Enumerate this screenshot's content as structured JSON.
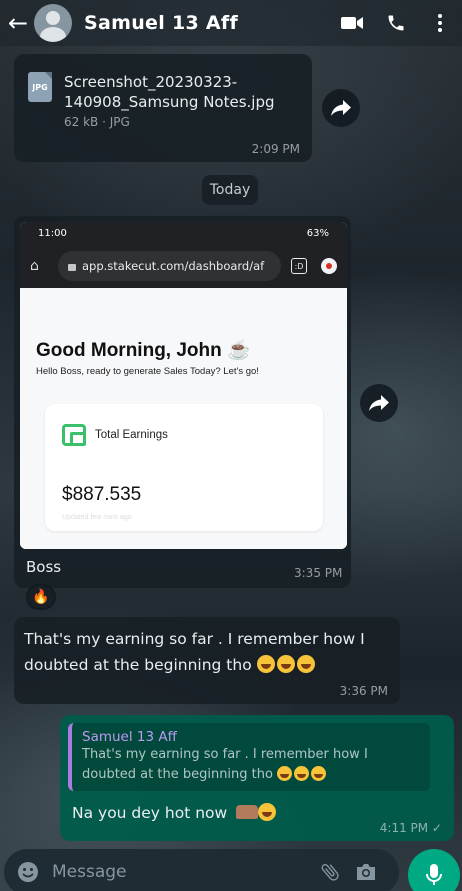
{
  "header": {
    "contact_name": "Samuel 13 Aff"
  },
  "messages": {
    "file": {
      "file_name": "Screenshot_20230323-140908_Samsung Notes.jpg",
      "file_meta": "62 kB · JPG",
      "file_type": "JPG",
      "time": "2:09 PM"
    },
    "date_divider": "Today",
    "image_message": {
      "caption": "Boss",
      "time": "3:35 PM",
      "reaction": "🔥",
      "screenshot": {
        "status_time": "11:00",
        "status_battery": "63%",
        "url": "app.stakecut.com/dashboard/af",
        "tabs_count": ":D",
        "greeting": "Good Morning, John ☕",
        "subtitle": "Hello Boss, ready to generate Sales Today? Let's go!",
        "card_label": "Total Earnings",
        "card_amount": "$887.535",
        "card_updated": "Updated few mins ago"
      }
    },
    "incoming_text": {
      "text": "That's my earning so far . I remember how I doubted at the beginning tho",
      "time": "3:36 PM"
    },
    "outgoing_reply": {
      "quote_author": "Samuel 13 Aff",
      "quote_text": "That's my earning so far . I remember how I doubted at the beginning tho",
      "text": "Na you dey hot now",
      "time": "4:11 PM ✓"
    }
  },
  "composer": {
    "placeholder": "Message"
  }
}
